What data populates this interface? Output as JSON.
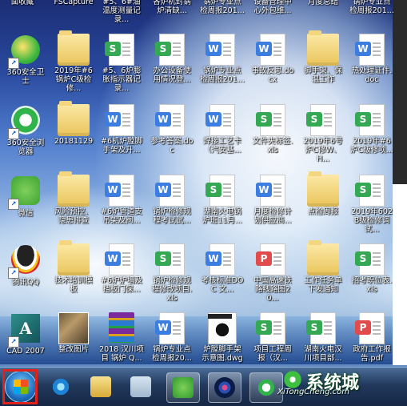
{
  "desktop": {
    "icons": [
      {
        "id": "top-0",
        "label": "面收藏"
      },
      {
        "id": "top-1",
        "label": "FSCapture"
      },
      {
        "id": "top-2",
        "label": "#5、6#油温度测量记录..."
      },
      {
        "id": "top-3",
        "label": "各炉机封锅炉清缺..."
      },
      {
        "id": "top-4",
        "label": "锅炉专业点检周报201..."
      },
      {
        "id": "top-5",
        "label": "设备管理中心外包维..."
      },
      {
        "id": "top-6",
        "label": "月度总结"
      },
      {
        "id": "top-7",
        "label": "锅炉专业点检周报201..."
      },
      {
        "id": "r1-0",
        "label": "360安全卫士"
      },
      {
        "id": "r1-1",
        "label": "2019年#6锅炉C级检修..."
      },
      {
        "id": "r1-2",
        "label": "#5、6炉膨胀指示器记录..."
      },
      {
        "id": "r1-3",
        "label": "办公设备使用情况登..."
      },
      {
        "id": "r1-4",
        "label": "锅炉专业点检周报201..."
      },
      {
        "id": "r1-5",
        "label": "事故反思.docx"
      },
      {
        "id": "r1-6",
        "label": "脚手架、保温工作"
      },
      {
        "id": "r1-7",
        "label": "热处理证件.doc"
      },
      {
        "id": "r2-0",
        "label": "360安全浏览器"
      },
      {
        "id": "r2-1",
        "label": "20181129"
      },
      {
        "id": "r2-2",
        "label": "#6机炉膛脚手架及升..."
      },
      {
        "id": "r2-3",
        "label": "参考答案.doc"
      },
      {
        "id": "r2-4",
        "label": "焊接工艺卡（汽安基..."
      },
      {
        "id": "r2-5",
        "label": "文件夹标签.xls"
      },
      {
        "id": "r2-6",
        "label": "2019年6号炉C修W、H..."
      },
      {
        "id": "r2-7",
        "label": "2019年#6炉C级修项..."
      },
      {
        "id": "r3-0",
        "label": "微信"
      },
      {
        "id": "r3-1",
        "label": "风险预控、隐患排查"
      },
      {
        "id": "r3-2",
        "label": "#6炉管道支吊架及阀..."
      },
      {
        "id": "r3-3",
        "label": "锅炉检修规程考试试..."
      },
      {
        "id": "r3-4",
        "label": "湖南火电锅炉班11月..."
      },
      {
        "id": "r3-5",
        "label": "月度检修计划供应商..."
      },
      {
        "id": "r3-6",
        "label": "点检周报"
      },
      {
        "id": "r3-7",
        "label": "2019年602B级检修调试..."
      },
      {
        "id": "r4-0",
        "label": "腾讯QQ"
      },
      {
        "id": "r4-1",
        "label": "技术培训模板"
      },
      {
        "id": "r4-2",
        "label": "#6炉炉墙及挡板门保..."
      },
      {
        "id": "r4-3",
        "label": "锅炉检修规程修改项目.xls"
      },
      {
        "id": "r4-4",
        "label": "考核标准DOC 文..."
      },
      {
        "id": "r4-5",
        "label": "中国高速铁路线路图20..."
      },
      {
        "id": "r4-6",
        "label": "工作任务单下发通知"
      },
      {
        "id": "r4-7",
        "label": "招考职位表.xls"
      },
      {
        "id": "r5-0",
        "label": "CAD 2007"
      },
      {
        "id": "r5-1",
        "label": "整改图片"
      },
      {
        "id": "r5-2",
        "label": "2018 汉川项目 锅炉 Q..."
      },
      {
        "id": "r5-3",
        "label": "锅炉专业点检周报20..."
      },
      {
        "id": "r5-4",
        "label": "炉膛脚手架示意图.dwg"
      },
      {
        "id": "r5-5",
        "label": "项目工程周报（汉..."
      },
      {
        "id": "r5-6",
        "label": "湖南火电汉川项目部..."
      },
      {
        "id": "r5-7",
        "label": "政府工作报告.pdf"
      }
    ]
  },
  "taskbar": {
    "items": [
      {
        "name": "start-button"
      },
      {
        "name": "internet-explorer"
      },
      {
        "name": "file-explorer"
      },
      {
        "name": "calculator"
      },
      {
        "name": "wechat"
      },
      {
        "name": "feather-app"
      },
      {
        "name": "360-browser"
      }
    ]
  },
  "watermark": {
    "text": "系统城",
    "url": "XiTongCheng.com"
  }
}
